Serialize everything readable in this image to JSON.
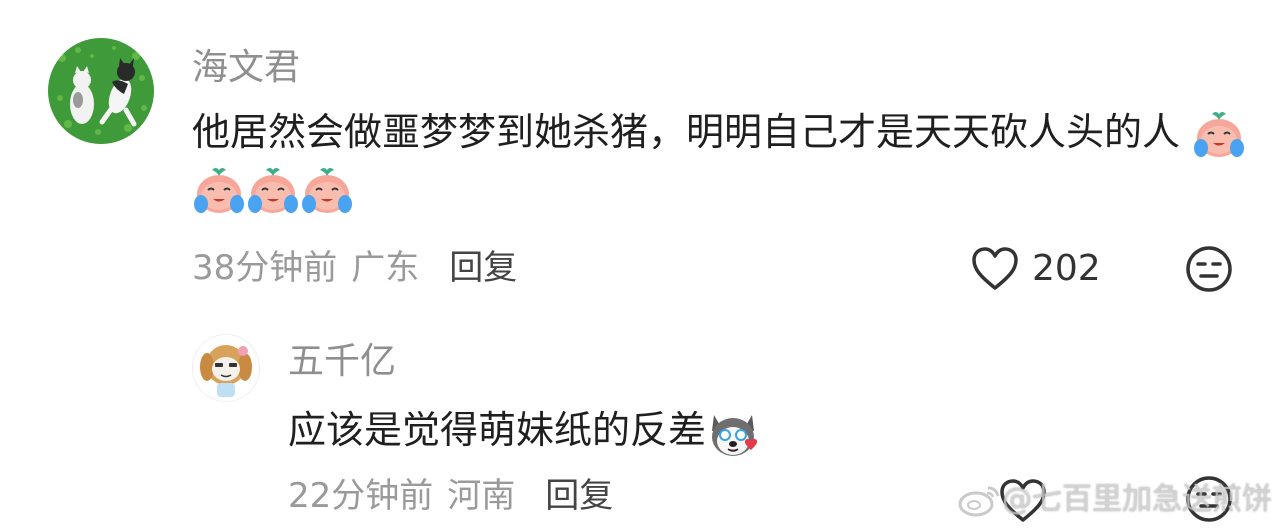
{
  "comments": [
    {
      "username": "海文君",
      "content": "他居然会做噩梦梦到她杀猪，明明自己才是天天砍人头的人",
      "emoji": "crying-peach-emoji",
      "emoji_count": 4,
      "time": "38分钟前",
      "location": "广东",
      "reply_label": "回复",
      "like_count": "202",
      "avatar": "cats-on-green-avatar"
    },
    {
      "username": "五千亿",
      "content": "应该是觉得萌妹纸的反差",
      "emoji": "husky-love-emoji",
      "time": "22分钟前",
      "location": "河南",
      "reply_label": "回复",
      "avatar": "cartoon-dog-girl-avatar"
    }
  ],
  "watermark": {
    "text": "@七百里加急送煎饼",
    "icon": "weibo-icon"
  },
  "colors": {
    "username": "#8f8f8f",
    "content": "#1f1f1f",
    "meta": "#9a9a9a",
    "reply": "#444444",
    "avatar_green": "#3f9a3a"
  }
}
